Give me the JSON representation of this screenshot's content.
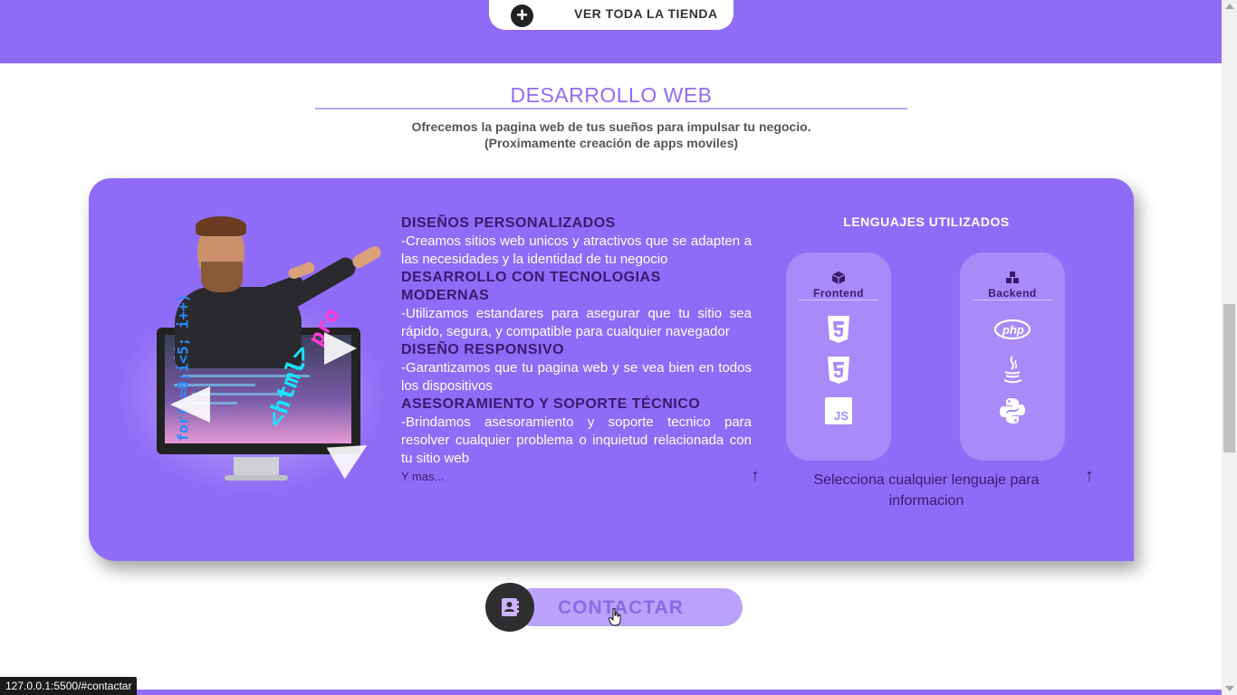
{
  "store_button": {
    "label": "VER TODA LA TIENDA",
    "icon": "plus-circle-icon"
  },
  "section": {
    "title": "DESARROLLO WEB",
    "subtitle_line1": "Ofrecemos la pagina web de tus sueños para impulsar tu negocio.",
    "subtitle_line2": "(Proximamente creación de apps moviles)"
  },
  "illustration": {
    "neon_text_1": "<html>",
    "neon_text_2": "pro",
    "neon_text_3": "for(i=0;i<5; i++)"
  },
  "features": [
    {
      "title": "DISEÑOS PERSONALIZADOS",
      "text": "-Creamos sitios web unicos y atractivos que se adapten a las necesidades y la identidad de tu negocio"
    },
    {
      "title": "DESARROLLO CON TECNOLOGIAS MODERNAS",
      "text": "-Utilizamos estandares para asegurar que tu sitio sea rápido, segura, y compatible para cualquier navegador"
    },
    {
      "title": "DISEÑO RESPONSIVO",
      "text": "-Garantizamos que tu pagina web y se vea bien en todos los dispositivos"
    },
    {
      "title": "ASESORAMIENTO Y SOPORTE TÉCNICO",
      "text": "-Brindamos asesoramiento y soporte tecnico para resolver cualquier problema o inquietud relacionada con tu sitio web"
    }
  ],
  "more_label": "Y mas...",
  "languages": {
    "title": "LENGUAJES UTILIZADOS",
    "frontend": {
      "label": "Frontend",
      "icons": [
        "html5-icon",
        "css3-icon",
        "javascript-icon"
      ],
      "js_text": "JS"
    },
    "backend": {
      "label": "Backend",
      "icons": [
        "php-icon",
        "java-icon",
        "python-icon"
      ],
      "php_text": "php"
    },
    "help": "Selecciona cualquier lenguaje para informacion",
    "arrow": "↑"
  },
  "contact_button": {
    "label": "CONTACTAR",
    "icon": "contact-book-icon"
  },
  "status_bar": {
    "url": "127.0.0.1:5500/#contactar"
  },
  "colors": {
    "accent": "#8f6cf7",
    "dark_text": "#3b1a6e",
    "card_light": "#a88bf8"
  }
}
